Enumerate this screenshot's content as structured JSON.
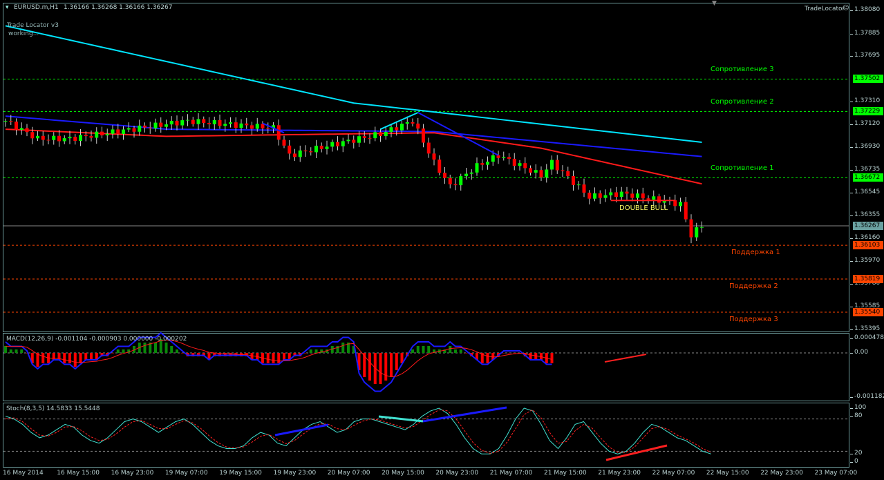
{
  "header": {
    "symbol": "EURUSD.m,H1",
    "ohlc": "1.36166 1.36268 1.36166 1.36267",
    "indicator_name": "Trade Locator v3",
    "indicator_status": "working...",
    "trade_locator": "TradeLocator"
  },
  "price_axis": [
    "1.38080",
    "1.37885",
    "1.37695",
    "1.37310",
    "1.37120",
    "1.36930",
    "1.36735",
    "1.36545",
    "1.36355",
    "1.36160",
    "1.35970",
    "1.35780",
    "1.35585",
    "1.35395"
  ],
  "levels": [
    {
      "label": "Сопротивление 3",
      "price": 1.37502,
      "text": "1.37502",
      "color": "#00ff00"
    },
    {
      "label": "Сопротивление 2",
      "price": 1.37229,
      "text": "1.37229",
      "color": "#00ff00"
    },
    {
      "label": "Сопротивление 1",
      "price": 1.36672,
      "text": "1.36672",
      "color": "#00ff00"
    },
    {
      "label": "Поддержка 1",
      "price": 1.36103,
      "text": "1.36103",
      "color": "#ff4500"
    },
    {
      "label": "Поддержка 2",
      "price": 1.35819,
      "text": "1.35819",
      "color": "#ff4500"
    },
    {
      "label": "Поддержка 3",
      "price": 1.3554,
      "text": "1.35540",
      "color": "#ff4500"
    }
  ],
  "current_price": {
    "price": 1.36267,
    "text": "1.36267"
  },
  "pattern_label": "DOUBLE BULL",
  "macd": {
    "label": "MACD(12,26,9) -0.001104 -0.000903 0.000000 -0.000202",
    "axis": [
      "0.000478",
      "0.00",
      "-0.001182"
    ]
  },
  "stoch": {
    "label": "Stoch(8,3,5) 14.5833 15.5448",
    "axis": [
      "100",
      "80",
      "20",
      "0"
    ]
  },
  "time_axis": [
    "16 May 2014",
    "16 May 15:00",
    "16 May 23:00",
    "19 May 07:00",
    "19 May 15:00",
    "19 May 23:00",
    "20 May 07:00",
    "20 May 15:00",
    "20 May 23:00",
    "21 May 07:00",
    "21 May 15:00",
    "21 May 23:00",
    "22 May 07:00",
    "22 May 15:00",
    "22 May 23:00",
    "23 May 07:00"
  ],
  "chart_data": {
    "type": "candlestick",
    "bars": 131,
    "price_path": [
      [
        0,
        1.3715
      ],
      [
        6,
        1.37
      ],
      [
        12,
        1.37
      ],
      [
        25,
        1.3709
      ],
      [
        34,
        1.3715
      ],
      [
        50,
        1.3709
      ],
      [
        53,
        1.3686
      ],
      [
        61,
        1.3695
      ],
      [
        70,
        1.3704
      ],
      [
        76,
        1.3715
      ],
      [
        80,
        1.368
      ],
      [
        83,
        1.366
      ],
      [
        88,
        1.3677
      ],
      [
        92,
        1.3686
      ],
      [
        100,
        1.3669
      ],
      [
        102,
        1.368
      ],
      [
        109,
        1.3651
      ],
      [
        115,
        1.3654
      ],
      [
        126,
        1.3645
      ],
      [
        128,
        1.3619
      ],
      [
        130,
        1.3627
      ]
    ],
    "ma_cyan": [
      [
        0,
        1.3795
      ],
      [
        65,
        1.373
      ],
      [
        77,
        1.3724
      ],
      [
        130,
        1.3697
      ]
    ],
    "ma_blue": [
      [
        0,
        1.3719
      ],
      [
        30,
        1.3708
      ],
      [
        80,
        1.3706
      ],
      [
        130,
        1.3685
      ]
    ],
    "ma_red": [
      [
        0,
        1.3708
      ],
      [
        30,
        1.3702
      ],
      [
        80,
        1.3705
      ],
      [
        100,
        1.3692
      ],
      [
        130,
        1.3662
      ]
    ],
    "macd_hist": [
      2,
      1,
      1,
      1,
      0,
      -3,
      -4,
      -3,
      -3,
      -2,
      -2,
      -3,
      -3,
      -4,
      -3,
      -2,
      -2,
      -2,
      -1,
      -1,
      0,
      1,
      1,
      1,
      2,
      3,
      3,
      3,
      3,
      4,
      3,
      2,
      1,
      0,
      -1,
      -1,
      -1,
      -1,
      -2,
      -1,
      -1,
      -1,
      -1,
      -1,
      -1,
      -1,
      -2,
      -2,
      -3,
      -3,
      -3,
      -3,
      -2,
      -2,
      -1,
      -1,
      0,
      1,
      1,
      1,
      1,
      2,
      2,
      3,
      3,
      2,
      -5,
      -7,
      -8,
      -9,
      -9,
      -8,
      -7,
      -5,
      -3,
      -1,
      1,
      2,
      2,
      2,
      1,
      1,
      1,
      2,
      1,
      1,
      0,
      -1,
      -2,
      -3,
      -3,
      -2,
      -1,
      0,
      0,
      0,
      0,
      -1,
      -2,
      -2,
      -2,
      -3,
      -3
    ],
    "stoch_main": [
      85,
      80,
      70,
      55,
      45,
      50,
      60,
      70,
      65,
      50,
      40,
      35,
      45,
      60,
      75,
      80,
      75,
      65,
      55,
      65,
      75,
      80,
      70,
      55,
      40,
      30,
      25,
      25,
      30,
      45,
      55,
      50,
      35,
      30,
      45,
      60,
      70,
      75,
      65,
      55,
      60,
      75,
      80,
      80,
      75,
      70,
      65,
      60,
      70,
      85,
      95,
      100,
      90,
      70,
      45,
      25,
      15,
      15,
      25,
      50,
      80,
      100,
      95,
      70,
      40,
      25,
      45,
      70,
      75,
      55,
      35,
      20,
      15,
      20,
      35,
      55,
      70,
      65,
      55,
      45,
      40,
      30,
      20,
      15
    ],
    "stoch_signal": [
      80,
      82,
      75,
      62,
      50,
      48,
      55,
      65,
      66,
      58,
      47,
      40,
      42,
      52,
      65,
      75,
      77,
      70,
      62,
      62,
      70,
      77,
      73,
      62,
      48,
      36,
      28,
      26,
      28,
      37,
      48,
      51,
      42,
      34,
      40,
      52,
      63,
      71,
      70,
      62,
      60,
      68,
      76,
      80,
      78,
      73,
      68,
      63,
      66,
      77,
      88,
      97,
      95,
      80,
      58,
      36,
      22,
      16,
      20,
      37,
      62,
      88,
      97,
      82,
      55,
      35,
      38,
      58,
      70,
      63,
      45,
      28,
      18,
      18,
      28,
      45,
      62,
      66,
      60,
      50,
      43,
      35,
      25,
      18
    ]
  }
}
